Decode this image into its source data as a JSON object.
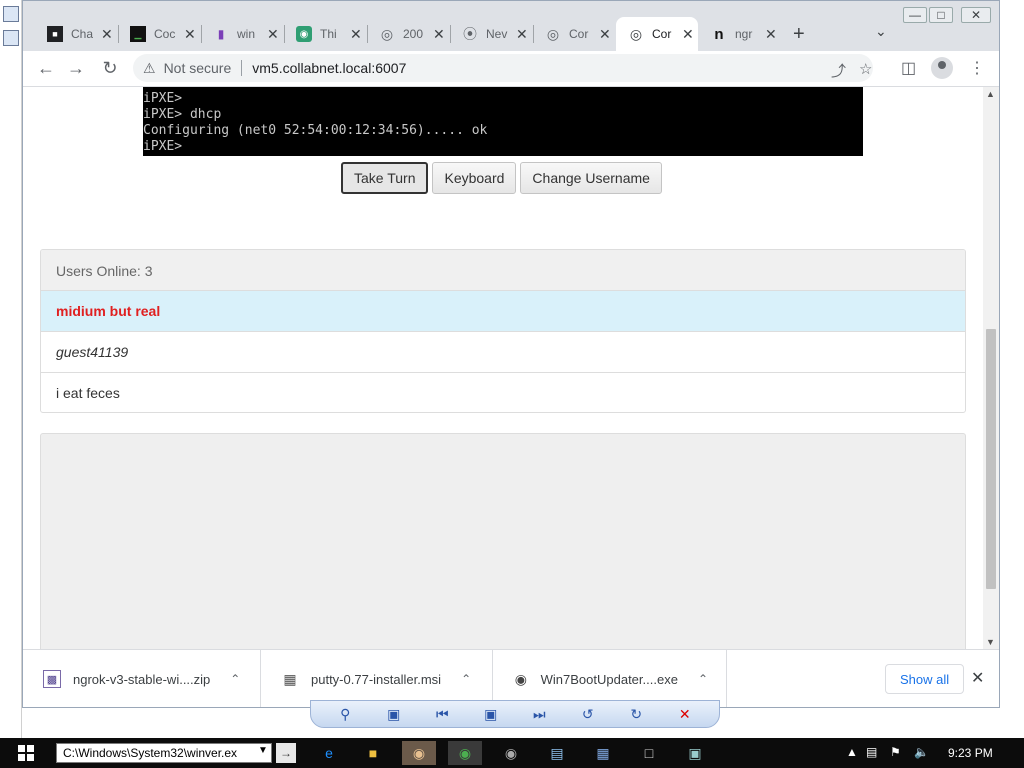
{
  "browser": {
    "tabs": [
      {
        "title": "Cha",
        "icon": "terminal-favicon",
        "active": false
      },
      {
        "title": "Coc",
        "icon": "chart-favicon",
        "active": false
      },
      {
        "title": "win",
        "icon": "bookmark-favicon",
        "active": false
      },
      {
        "title": "Thi",
        "icon": "puzzle-favicon",
        "active": false
      },
      {
        "title": "200",
        "icon": "globe-favicon",
        "active": false
      },
      {
        "title": "Nev",
        "icon": "chrome-favicon",
        "active": false
      },
      {
        "title": "Cor",
        "icon": "globe-favicon",
        "active": false
      },
      {
        "title": "Cor",
        "icon": "globe-favicon",
        "active": true
      },
      {
        "title": "ngr",
        "icon": "ngrok-favicon",
        "active": false
      }
    ],
    "address": {
      "security_label": "Not secure",
      "url": "vm5.collabnet.local:6007"
    }
  },
  "terminal": {
    "lines": [
      "iPXE>",
      "iPXE> dhcp",
      "Configuring (net0 52:54:00:12:34:56)..... ok",
      "iPXE>"
    ]
  },
  "controls": {
    "take_turn": "Take Turn",
    "keyboard": "Keyboard",
    "change_username": "Change Username"
  },
  "users": {
    "header": "Users Online: 3",
    "list": [
      {
        "name": "midium but real",
        "kind": "current"
      },
      {
        "name": "guest41139",
        "kind": "guest"
      },
      {
        "name": "i eat feces",
        "kind": "normal"
      }
    ]
  },
  "downloads": {
    "items": [
      {
        "name": "ngrok-v3-stable-wi....zip"
      },
      {
        "name": "putty-0.77-installer.msi"
      },
      {
        "name": "Win7BootUpdater....exe"
      }
    ],
    "show_all": "Show all"
  },
  "taskbar": {
    "run_value": "C:\\Windows\\System32\\winver.ex",
    "clock": "9:23 PM"
  },
  "colors": {
    "current_user": "#e02020",
    "current_user_bg": "#d9f1fa",
    "link_blue": "#1a73e8"
  }
}
